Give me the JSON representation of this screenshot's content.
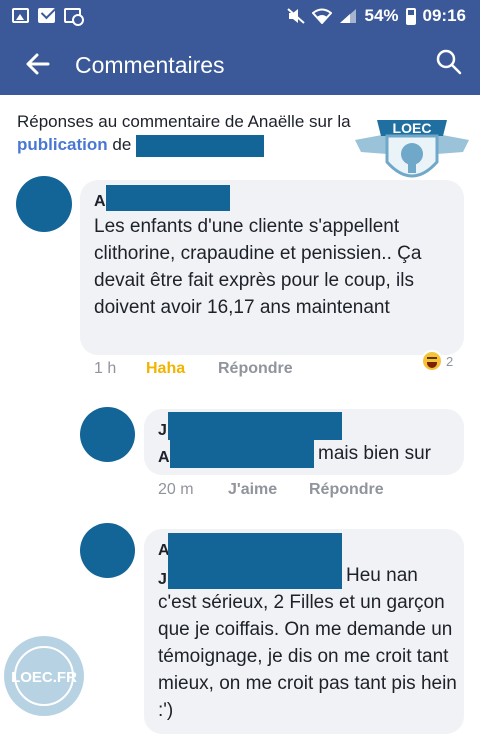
{
  "status_bar": {
    "battery": "54%",
    "time": "09:16"
  },
  "app_bar": {
    "title": "Commentaires"
  },
  "context": {
    "prefix": "Réponses au commentaire de Anaëlle sur la",
    "link": "publication",
    "suffix": "de"
  },
  "comments": [
    {
      "author_initial": "A",
      "text": "Les enfants d'une cliente s'appellent clithorine, crapaudine et penissien.. Ça devait être fait exprès pour le coup, ils doivent avoir 16,17 ans maintenant",
      "time": "1 h",
      "reaction_label": "Haha",
      "reply_label": "Répondre",
      "reaction_count": "2"
    },
    {
      "author_initial": "J",
      "mention_initial": "A",
      "text": "mais bien sur",
      "time": "20 m",
      "like_label": "J'aime",
      "reply_label": "Répondre"
    },
    {
      "author_initial": "A",
      "mention_initial": "J",
      "text": "Heu nan c'est sérieux, 2 Filles et un garçon  que je coiffais. On me demande un témoignage, je dis on me croit tant mieux, on me croit pas tant pis hein :')"
    }
  ],
  "watermarks": {
    "badge": "LOEC",
    "seal": "LOEC.FR"
  }
}
